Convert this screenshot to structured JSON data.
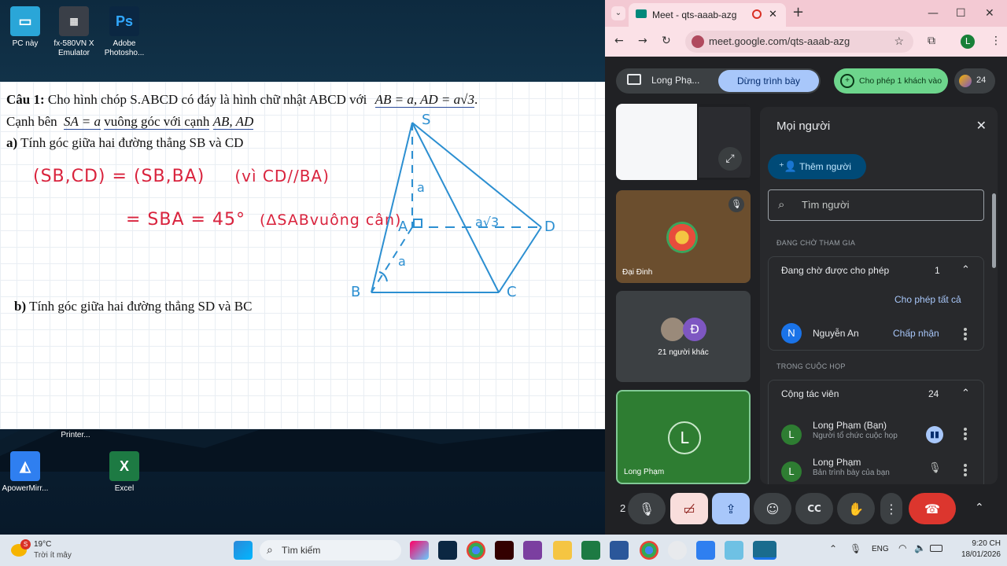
{
  "desktop": {
    "icons": [
      {
        "label": "PC này"
      },
      {
        "label": "fx-580VN X Emulator"
      },
      {
        "label": "Adobe Photosho..."
      },
      {
        "label": "Printer..."
      },
      {
        "label": "ApowerMirr..."
      },
      {
        "label": "Excel"
      }
    ]
  },
  "board": {
    "q1_label": "Câu 1:",
    "q1_text": "Cho hình chóp S.ABCD có đáy là hình chữ nhật  ABCD  với",
    "q1_cond": "AB = a, AD = a√3",
    "q1_end": ".",
    "edge_prefix": "Cạnh bên",
    "edge_cond": "SA = a",
    "edge_mid": "vuông góc với cạnh",
    "edge_cond2": "AB, AD",
    "a_label": "a)",
    "a_text": "Tính góc giữa hai đường thẳng SB và CD",
    "b_label": "b)",
    "b_text": "Tính góc giữa hai đường thẳng SD và BC",
    "hand_line1a": "(SB,CD) = (SB,BA)",
    "hand_line1b": "(vì CD//BA)",
    "hand_line2a": "= SBA = 45°",
    "hand_line2b": "(ΔSABvuông cân)",
    "fig_S": "S",
    "fig_A": "A",
    "fig_B": "B",
    "fig_C": "C",
    "fig_D": "D",
    "fig_a1": "a",
    "fig_a2": "a",
    "fig_a3": "a√3"
  },
  "browser": {
    "tab_title": "Meet - qts-aaab-azg",
    "url": "meet.google.com/qts-aaab-azg",
    "profile_initial": "L"
  },
  "meet": {
    "presenter": "Long Phạ...",
    "stop_presenting": "Dừng trình bày",
    "allow_guest": "Cho phép 1 khách vào",
    "participant_count": "24",
    "tiles": [
      {
        "name": ""
      },
      {
        "name": "Đại Đinh"
      },
      {
        "name": "21 người khác"
      },
      {
        "name": "Long Phạm",
        "initial": "L"
      }
    ],
    "others_initial": "Đ",
    "panel": {
      "title": "Mọi người",
      "add_people": "Thêm người",
      "search_placeholder": "Tìm người",
      "waiting_section": "ĐANG CHỜ THAM GIA",
      "waiting_group": "Đang chờ được cho phép",
      "waiting_count": "1",
      "allow_all": "Cho phép tất cả",
      "waiting_person": {
        "initial": "N",
        "name": "Nguyễn An",
        "action": "Chấp nhận"
      },
      "in_meeting_section": "TRONG CUỘC HỌP",
      "collab_group": "Cộng tác viên",
      "collab_count": "24",
      "members": [
        {
          "initial": "L",
          "name": "Long Phạm (Bạn)",
          "sub": "Người tổ chức cuộc họp"
        },
        {
          "initial": "L",
          "name": "Long Phạm",
          "sub": "Bản trình bày của bạn"
        }
      ]
    },
    "controls_partial": "2"
  },
  "taskbar": {
    "weather_temp": "19°C",
    "weather_desc": "Trời ít mây",
    "weather_badge": "S",
    "search_placeholder": "Tìm kiếm",
    "lang": "ENG",
    "time": "9:20 CH",
    "date": "18/01/2026"
  },
  "colors": {
    "meet_green": "#6dd58c",
    "stop_blue": "#a8c7fa",
    "end_red": "#dc362e",
    "hand_red": "#d9233d",
    "figure_blue": "#2c8fd1"
  }
}
